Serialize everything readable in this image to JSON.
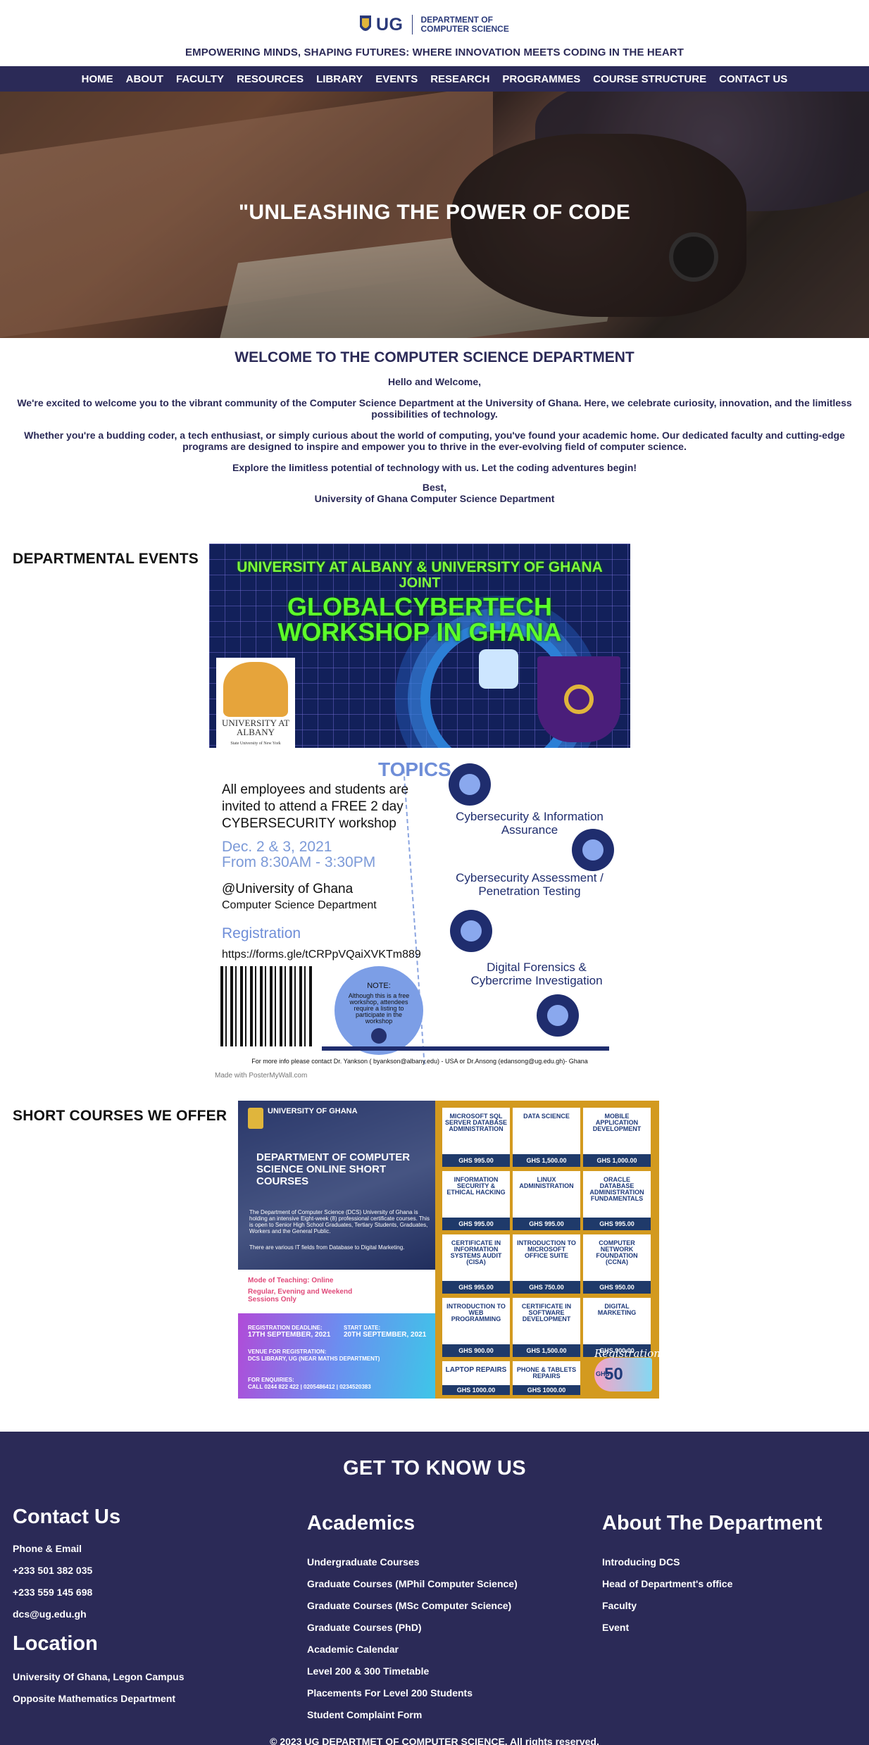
{
  "header": {
    "logo_mark": "UG",
    "logo_dept_line1": "DEPARTMENT OF",
    "logo_dept_line2": "COMPUTER SCIENCE",
    "tagline": "EMPOWERING MINDS, SHAPING FUTURES: WHERE INNOVATION MEETS CODING IN THE HEART"
  },
  "nav": {
    "items": [
      "HOME",
      "ABOUT",
      "FACULTY",
      "RESOURCES",
      "LIBRARY",
      "EVENTS",
      "RESEARCH",
      "PROGRAMMES",
      "COURSE STRUCTURE",
      "CONTACT US"
    ]
  },
  "hero": {
    "headline": "\"UNLEASHING THE POWER OF CODE"
  },
  "welcome": {
    "title": "WELCOME TO THE COMPUTER SCIENCE DEPARTMENT",
    "greeting": "Hello and Welcome,",
    "para1": "We're excited to welcome you to the vibrant community of the Computer Science Department at the University of Ghana. Here, we celebrate curiosity, innovation, and the limitless possibilities of technology.",
    "para2": "Whether you're a budding coder, a tech enthusiast, or simply curious about the world of computing, you've found your academic home. Our dedicated faculty and cutting-edge programs are designed to inspire and empower you to thrive in the ever-evolving field of computer science.",
    "para3": "Explore the limitless potential of technology with us. Let the coding adventures begin!",
    "closing": "Best,",
    "signature": "University of Ghana Computer Science Department"
  },
  "events": {
    "heading": "DEPARTMENTAL EVENTS",
    "poster": {
      "line1": "UNIVERSITY AT ALBANY & UNIVERSITY OF GHANA",
      "line2": "JOINT",
      "line3a": "GLOBALCYBERTECH",
      "line3b": "WORKSHOP IN GHANA",
      "albany": "UNIVERSITY AT ALBANY",
      "albany_sub": "State University of New York",
      "topics_label": "TOPICS",
      "invite": "All employees and students are invited to attend a FREE 2 day CYBERSECURITY workshop",
      "date_line1": "Dec. 2 & 3, 2021",
      "date_line2": "From 8:30AM - 3:30PM",
      "venue": "@University of Ghana",
      "venue_dept": "Computer Science Department",
      "registration": "Registration",
      "reg_link": "https://forms.gle/tCRPpVQaiXVKTm889",
      "note_title": "NOTE:",
      "note_text": "Although this is a free workshop, attendees require a listing to participate in the workshop",
      "topic1": "Cybersecurity & Information Assurance",
      "topic2": "Cybersecurity Assessment / Penetration Testing",
      "topic3": "Digital Forensics & Cybercrime Investigation",
      "footer": "For more info please contact Dr. Yankson ( byankson@albany.edu) - USA   or Dr.Ansong (edansong@ug.edu.gh)- Ghana",
      "credit": "Made with PosterMyWall.com"
    }
  },
  "courses": {
    "heading": "SHORT COURSES WE OFFER",
    "poster": {
      "ug_name": "UNIVERSITY OF GHANA",
      "title": "DEPARTMENT OF COMPUTER SCIENCE ONLINE SHORT COURSES",
      "desc": "The Department of Computer Science (DCS) University of Ghana is holding an intensive Eight-week (8) professional certificate courses. This is open to Senior High School Graduates, Tertiary Students, Graduates, Workers and the General Public.",
      "desc2": "There are various IT fields from Database to Digital Marketing.",
      "mode": "Mode of Teaching: Online",
      "sessions": "Regular, Evening and Weekend Sessions Only",
      "deadline_label": "REGISTRATION DEADLINE:",
      "deadline": "17TH SEPTEMBER, 2021",
      "start_label": "START DATE:",
      "start": "20TH SEPTEMBER, 2021",
      "venue_label": "VENUE FOR REGISTRATION:",
      "venue": "DCS LIBRARY, UG (NEAR MATHS DEPARTMENT)",
      "enquiries_label": "FOR ENQUIRIES:",
      "enquiries": "CALL 0244 822 422  |  0205486412  |  0234520383",
      "badge_currency": "GHS",
      "badge_amount": "50",
      "script": "Registration",
      "cards": [
        {
          "title": "MICROSOFT SQL SERVER DATABASE ADMINISTRATION",
          "price": "GHS 995.00"
        },
        {
          "title": "DATA SCIENCE",
          "price": "GHS 1,500.00"
        },
        {
          "title": "MOBILE APPLICATION DEVELOPMENT",
          "price": "GHS 1,000.00"
        },
        {
          "title": "INFORMATION SECURITY & ETHICAL HACKING",
          "price": "GHS 995.00"
        },
        {
          "title": "LINUX ADMINISTRATION",
          "price": "GHS 995.00"
        },
        {
          "title": "ORACLE DATABASE ADMINISTRATION FUNDAMENTALS",
          "price": "GHS 995.00"
        },
        {
          "title": "CERTIFICATE IN INFORMATION SYSTEMS AUDIT (CISA)",
          "price": "GHS 995.00"
        },
        {
          "title": "INTRODUCTION TO MICROSOFT OFFICE SUITE",
          "price": "GHS 750.00"
        },
        {
          "title": "COMPUTER NETWORK FOUNDATION (CCNA)",
          "price": "GHS 950.00"
        },
        {
          "title": "INTRODUCTION TO WEB PROGRAMMING",
          "price": "GHS 900.00"
        },
        {
          "title": "CERTIFICATE IN SOFTWARE DEVELOPMENT",
          "price": "GHS 1,500.00"
        },
        {
          "title": "DIGITAL MARKETING",
          "price": "GHS 900.00"
        },
        {
          "title": "LAPTOP REPAIRS",
          "price": "GHS 1000.00"
        },
        {
          "title": "PHONE & TABLETS REPAIRS",
          "price": "GHS 1000.00"
        }
      ]
    }
  },
  "footer": {
    "title": "GET TO KNOW US",
    "contact": {
      "heading": "Contact Us",
      "items": [
        "Phone & Email",
        "+233 501 382 035",
        "+233 559 145 698",
        "dcs@ug.edu.gh"
      ]
    },
    "location": {
      "heading": "Location",
      "items": [
        "University Of Ghana, Legon Campus",
        "Opposite Mathematics Department"
      ]
    },
    "academics": {
      "heading": "Academics",
      "items": [
        "Undergraduate Courses",
        "Graduate Courses (MPhil Computer Science)",
        "Graduate Courses (MSc Computer Science)",
        "Graduate Courses (PhD)",
        "Academic Calendar",
        "Level 200 & 300 Timetable",
        "Placements For Level 200 Students",
        "Student Complaint Form"
      ]
    },
    "about": {
      "heading": "About The Department",
      "items": [
        "Introducing DCS",
        "Head of Department's office",
        "Faculty",
        "Event"
      ]
    },
    "copyright": "© 2023 UG DEPARTMET OF COMPUTER SCIENCE. All rights reserved."
  },
  "colors": {
    "brand_navy": "#2b2a57",
    "poster_green": "#5cff2a",
    "poster_blue": "#6f8ed8",
    "courses_gold": "#d39a1f"
  },
  "icons": [
    "ug-crest-icon"
  ]
}
